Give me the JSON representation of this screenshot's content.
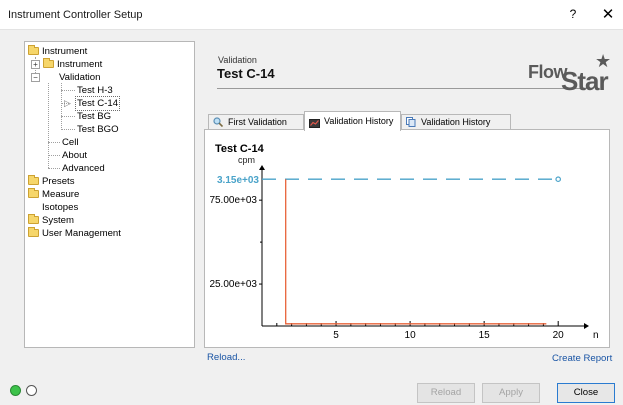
{
  "window": {
    "title": "Instrument Controller Setup",
    "help": "?",
    "close": "✕"
  },
  "tree": {
    "root": "Instrument",
    "instrument_child": "Instrument",
    "validation": "Validation",
    "tests": [
      "Test H-3",
      "Test C-14",
      "Test BG",
      "Test BGO"
    ],
    "cell": "Cell",
    "about": "About",
    "advanced": "Advanced",
    "presets": "Presets",
    "measure": "Measure",
    "isotopes": "Isotopes",
    "system": "System",
    "user_management": "User Management",
    "expander_plus": "+",
    "expander_minus": "−"
  },
  "page": {
    "subtitle": "Validation",
    "title": "Test C-14"
  },
  "logo": {
    "part1": "Flow",
    "part2": "Star"
  },
  "tabs": [
    "First Validation",
    "Validation History",
    "Validation History"
  ],
  "chart_data": {
    "type": "line",
    "title": "Test C-14",
    "ylabel": "cpm",
    "xlabel": "n",
    "x_ticks": [
      5,
      10,
      15,
      20
    ],
    "y_ticks": [
      "75.00e+03",
      "25.00e+03"
    ],
    "xlim": [
      0,
      21
    ],
    "ylim": [
      0,
      90000
    ],
    "reference_line": {
      "label": "3.15e+03",
      "value": 87500,
      "color": "#4aa3c9"
    },
    "series": [
      {
        "color": "#e8633a",
        "x": [
          1.6,
          1.6,
          19.2
        ],
        "y": [
          87500,
          1300,
          1300
        ]
      }
    ]
  },
  "links": {
    "reload": "Reload...",
    "create_report": "Create Report"
  },
  "buttons": {
    "reload": "Reload",
    "apply": "Apply",
    "close": "Close"
  }
}
